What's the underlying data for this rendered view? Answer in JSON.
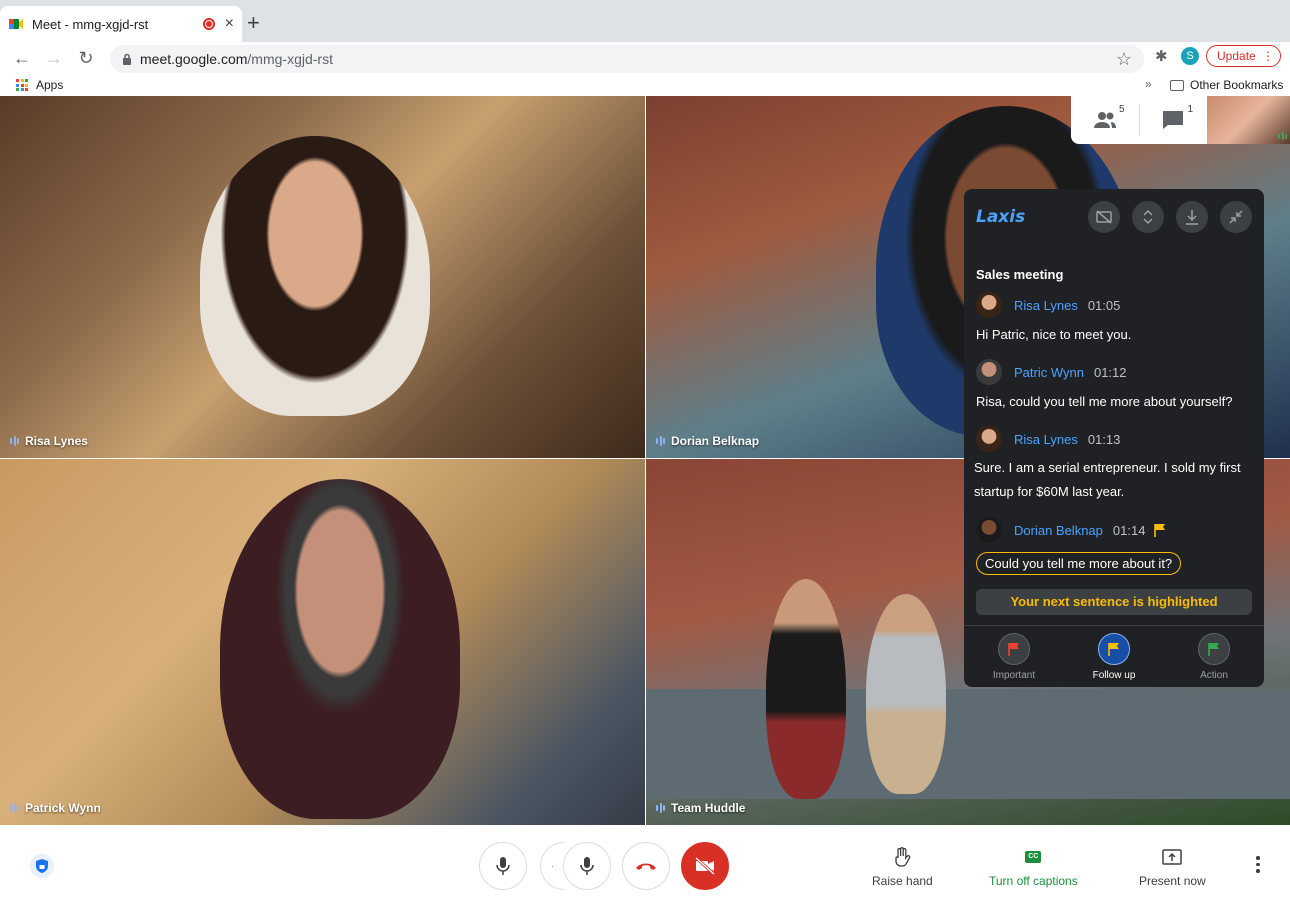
{
  "browser": {
    "tab_title": "Meet - mmg-xgjd-rst",
    "tab_close": "×",
    "new_tab": "+",
    "url_host": "meet.google.com",
    "url_path": "/mmg-xgjd-rst",
    "profile_initial": "S",
    "update_label": "Update",
    "update_menu": "⋮",
    "bookmarks_apps": "Apps",
    "bookmarks_more": "»",
    "other_bookmarks": "Other Bookmarks"
  },
  "meeting": {
    "tiles": [
      {
        "name": "Risa Lynes"
      },
      {
        "name": "Dorian Belknap"
      },
      {
        "name": "Patrick Wynn"
      },
      {
        "name": "Team Huddle"
      }
    ],
    "participants_count": "5",
    "chat_count": "1"
  },
  "laxis": {
    "logo": "Laxis",
    "title": "Sales meeting",
    "messages": [
      {
        "speaker": "Risa Lynes",
        "time": "01:05",
        "text": "Hi Patric, nice to meet you."
      },
      {
        "speaker": "Patric Wynn",
        "time": "01:12",
        "text": "Risa, could you tell me more about yourself?"
      },
      {
        "speaker": "Risa Lynes",
        "time": "01:13",
        "text": "Sure. I am a serial entrepreneur. I sold my first startup for $60M last year."
      },
      {
        "speaker": "Dorian Belknap",
        "time": "01:14",
        "text": "Could you tell me more about it?"
      }
    ],
    "next_sentence": "Your next sentence is highlighted",
    "actions": [
      {
        "label": "Important",
        "color": "#ea4335"
      },
      {
        "label": "Follow up",
        "color": "#fbbc04"
      },
      {
        "label": "Action",
        "color": "#34a853"
      }
    ]
  },
  "controls": {
    "raise_hand": "Raise hand",
    "captions": "Turn off captions",
    "cc": "CC",
    "present": "Present now"
  },
  "colors": {
    "accent_blue": "#4aa3ff",
    "end_call_red": "#d93025",
    "captions_green": "#1e8e3e",
    "highlight_yellow": "#fbbc04"
  }
}
